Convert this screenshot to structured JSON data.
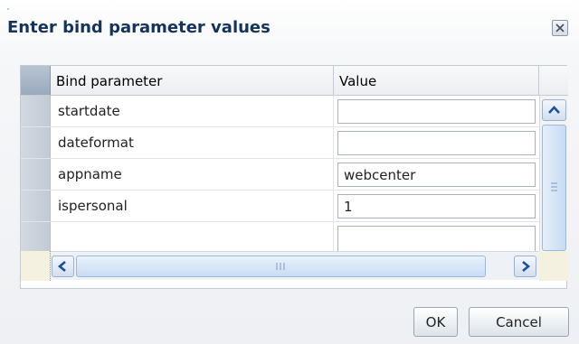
{
  "dialog": {
    "title": "Enter bind parameter values"
  },
  "table": {
    "columns": [
      "Bind parameter",
      "Value"
    ],
    "rows": [
      {
        "parameter": "startdate",
        "value": ""
      },
      {
        "parameter": "dateformat",
        "value": ""
      },
      {
        "parameter": "appname",
        "value": "webcenter"
      },
      {
        "parameter": "ispersonal",
        "value": "1"
      }
    ]
  },
  "buttons": {
    "ok": "OK",
    "cancel": "Cancel"
  },
  "icons": {
    "close": "close-icon",
    "scroll_up": "chevron-up-icon",
    "scroll_down": "chevron-down-icon",
    "scroll_left": "chevron-left-icon",
    "scroll_right": "chevron-right-icon"
  },
  "colors": {
    "title": "#16345a",
    "scroll_accent": "#1e4f9a"
  }
}
